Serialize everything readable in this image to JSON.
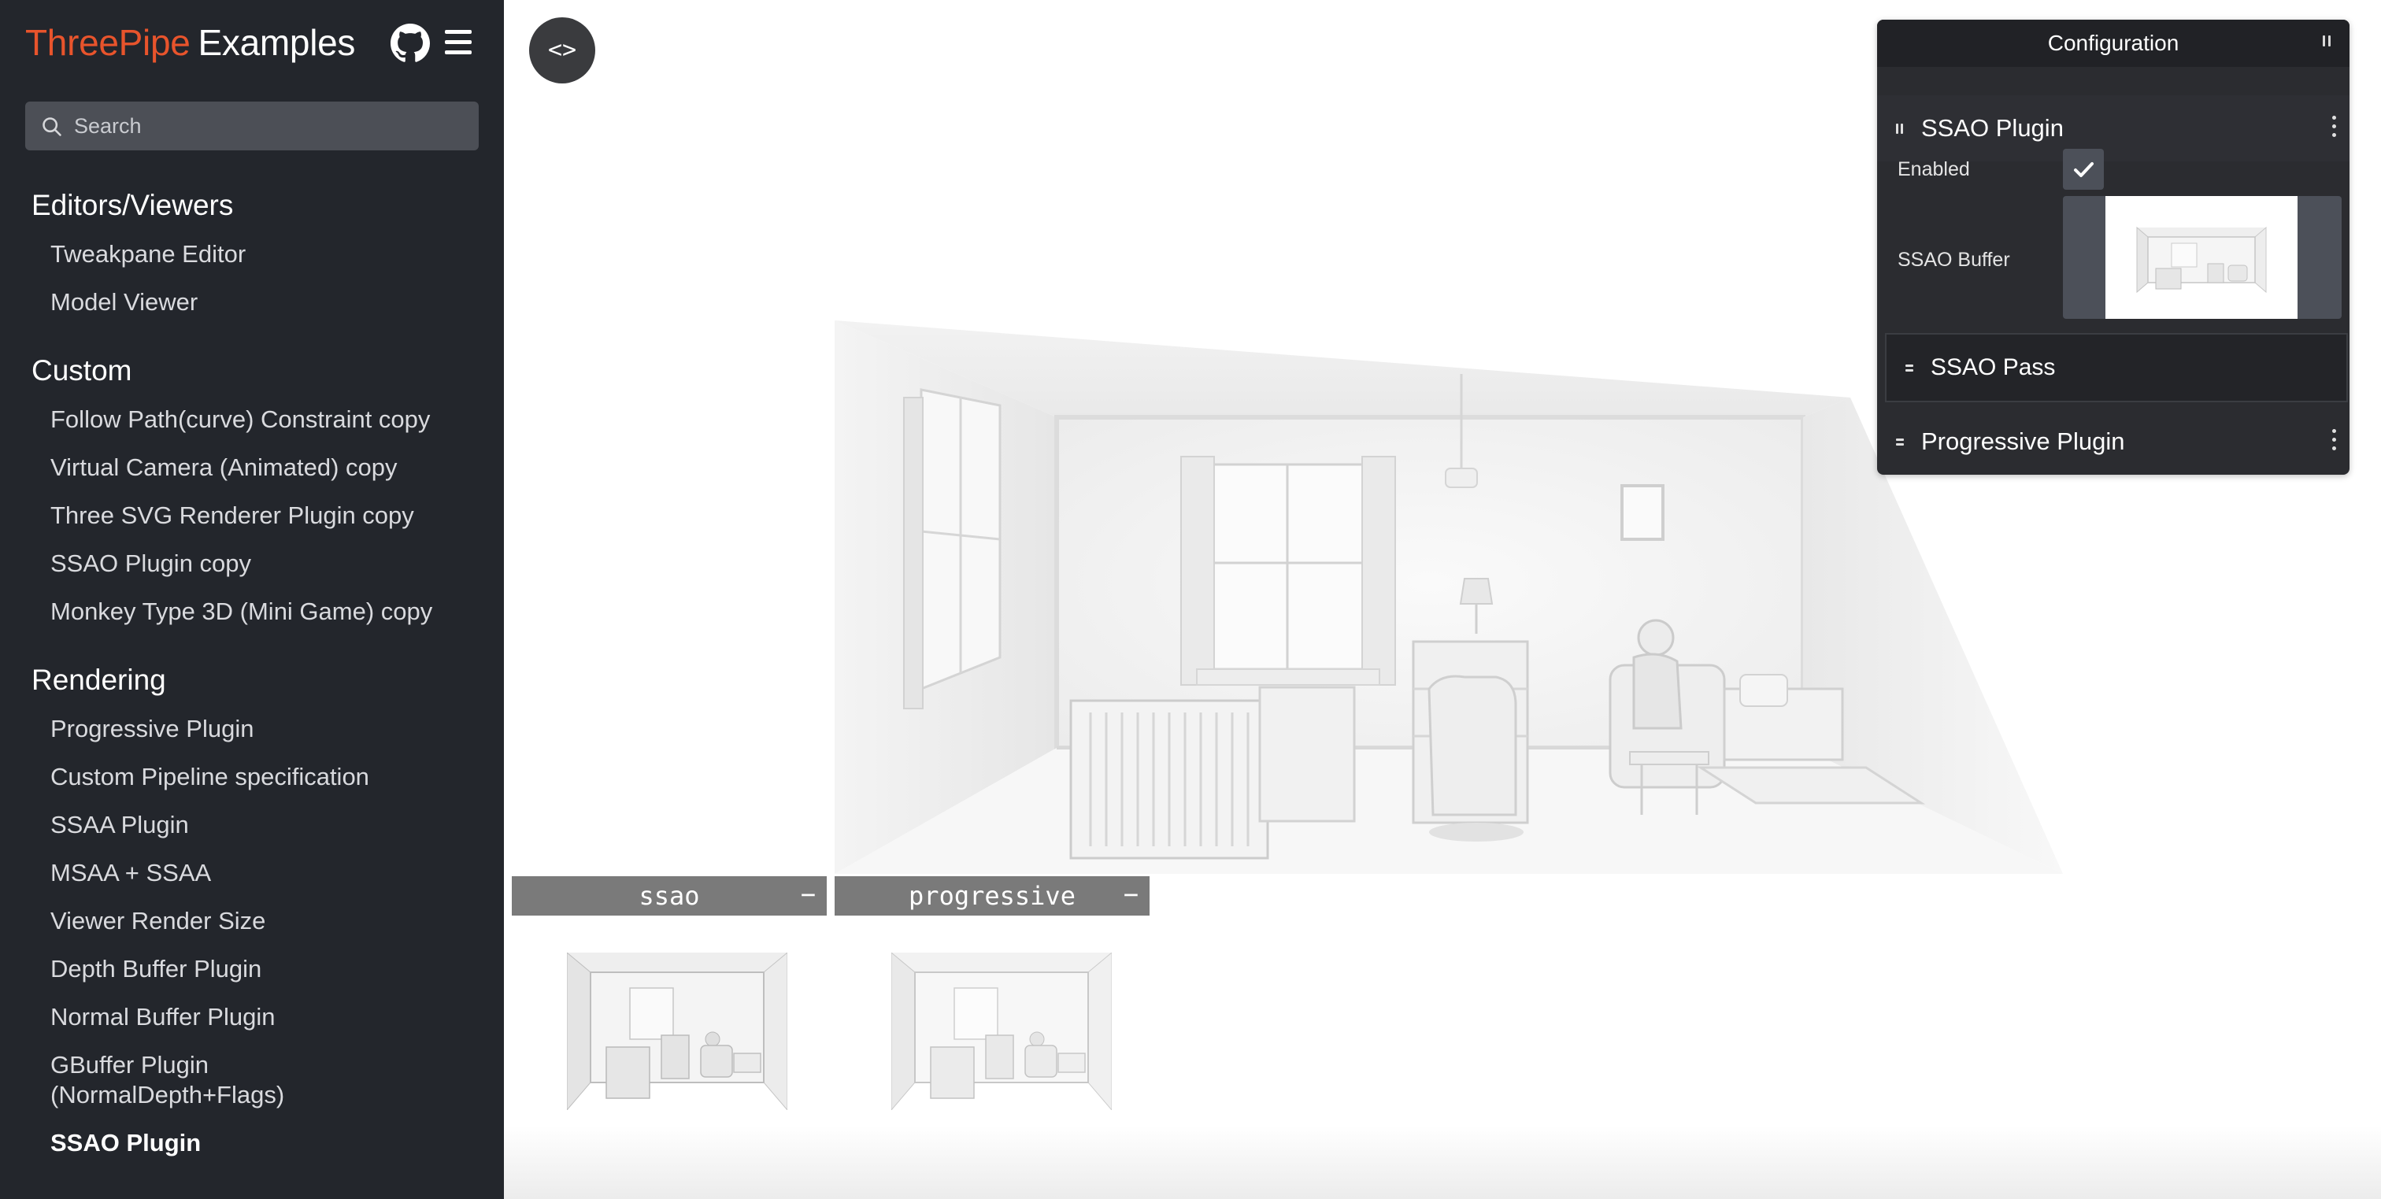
{
  "brand": {
    "primary": "ThreePipe",
    "secondary": "Examples",
    "accent_color": "#e8542c"
  },
  "header": {
    "github_icon": "github-icon",
    "menu_icon": "hamburger-menu-icon"
  },
  "search": {
    "placeholder": "Search",
    "value": ""
  },
  "nav": {
    "sections": [
      {
        "heading": "Editors/Viewers",
        "items": [
          "Tweakpane Editor",
          "Model Viewer"
        ]
      },
      {
        "heading": "Custom",
        "items": [
          "Follow Path(curve) Constraint copy",
          "Virtual Camera (Animated) copy",
          "Three SVG Renderer Plugin copy",
          "SSAO Plugin copy",
          "Monkey Type 3D (Mini Game) copy"
        ]
      },
      {
        "heading": "Rendering",
        "items": [
          "Progressive Plugin",
          "Custom Pipeline specification",
          "SSAA Plugin",
          "MSAA + SSAA",
          "Viewer Render Size",
          "Depth Buffer Plugin",
          "Normal Buffer Plugin",
          "GBuffer Plugin (NormalDepth+Flags)",
          "SSAO Plugin"
        ]
      }
    ],
    "active_item": "SSAO Plugin"
  },
  "main": {
    "code_toggle_label": "<>",
    "buffer_panels": [
      {
        "label": "ssao",
        "collapse": "−"
      },
      {
        "label": "progressive",
        "collapse": "−"
      }
    ]
  },
  "config": {
    "title": "Configuration",
    "folders": [
      {
        "title": "SSAO Plugin",
        "expanded": true,
        "rows": [
          {
            "label": "Enabled",
            "type": "checkbox",
            "checked": true
          },
          {
            "label": "SSAO Buffer",
            "type": "image-preview"
          }
        ],
        "subfolder": {
          "title": "SSAO Pass",
          "expanded": false
        }
      },
      {
        "title": "Progressive Plugin",
        "expanded": false
      }
    ]
  }
}
